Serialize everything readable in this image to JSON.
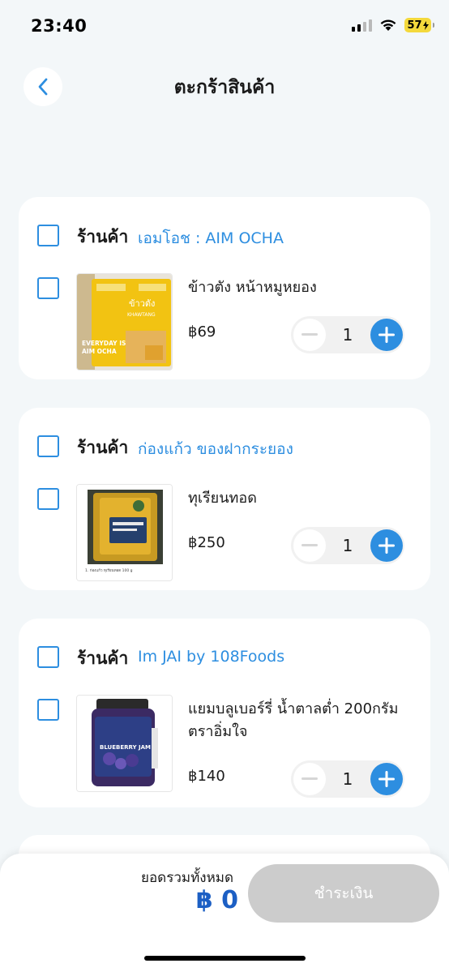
{
  "status_bar": {
    "time": "23:40",
    "battery": "57"
  },
  "header": {
    "title": "ตะกร้าสินค้า"
  },
  "shop_prefix": "ร้านค้า",
  "shops": [
    {
      "name": "เอมโอช : AIM OCHA",
      "item": {
        "name": "ข้าวตัง หน้าหมูหยอง",
        "price": "฿69",
        "quantity": "1",
        "thumb_lines": [
          "ข้าวตัง",
          "KHAWTANG",
          "EVERYDAY IS",
          "AIM OCHA"
        ]
      }
    },
    {
      "name": "ก่องแก้ว ของฝากระยอง",
      "item": {
        "name": "ทุเรียนทอด",
        "price": "฿250",
        "quantity": "1",
        "thumb_lines": [
          "1. ก่องแก้ว ทุเรียนทอด 100 g"
        ]
      }
    },
    {
      "name": "Im JAI by 108Foods",
      "item": {
        "name": "แยมบลูเบอร์รี่ น้ำตาลต่ำ 200กรัม ตราอิ่มใจ",
        "price": "฿140",
        "quantity": "1",
        "thumb_lines": [
          "BLUEBERRY JAM"
        ]
      }
    }
  ],
  "footer": {
    "total_label": "ยอดรวมทั้งหมด",
    "total_value": "฿ 0",
    "checkout_label": "ชำระเงิน"
  },
  "colors": {
    "accent": "#2d8ee0",
    "total": "#1c5fc4",
    "disabled": "#cccccc"
  }
}
